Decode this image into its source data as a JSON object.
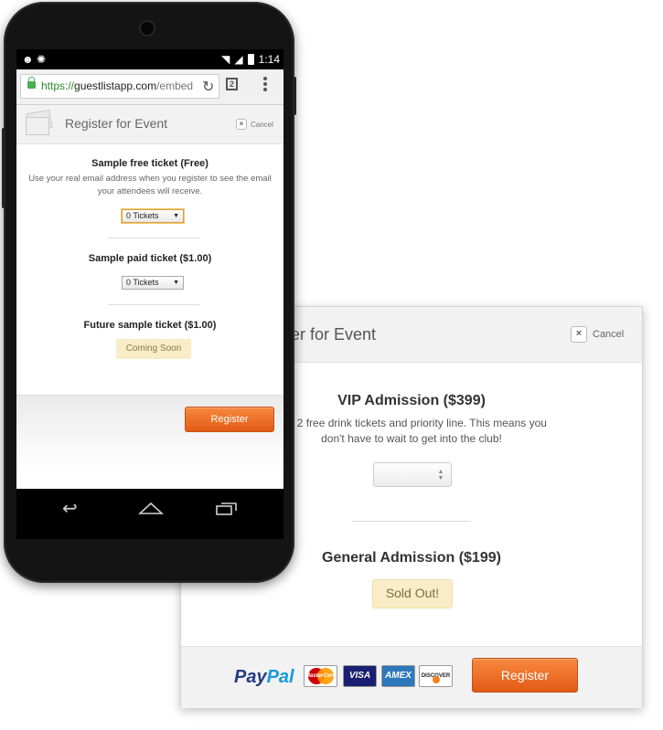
{
  "desktop": {
    "title": "er for Event",
    "cancel_label": "Cancel",
    "tickets": [
      {
        "name": "VIP Admission ($399)",
        "description": "des 2 free drink tickets and priority line. This means you don't have to wait to get into the club!",
        "select_value": ""
      },
      {
        "name": "General Admission ($199)",
        "status": "Sold Out!"
      }
    ],
    "payment": {
      "paypal_a": "Pay",
      "paypal_b": "Pal",
      "cards": [
        "MasterCard",
        "VISA",
        "AMEX",
        "DISCOVER"
      ]
    },
    "register_label": "Register"
  },
  "phone": {
    "status": {
      "time": "1:14"
    },
    "browser": {
      "url_scheme": "https://",
      "url_host": "guestlistapp.com",
      "url_path": "/embed",
      "tab_count": "2"
    },
    "title": "Register for Event",
    "cancel_label": "Cancel",
    "tickets": [
      {
        "name": "Sample free ticket (Free)",
        "description": "Use your real email address when you register to see the email your attendees will receive.",
        "select_value": "0 Tickets"
      },
      {
        "name": "Sample paid ticket ($1.00)",
        "select_value": "0 Tickets"
      },
      {
        "name": "Future sample ticket ($1.00)",
        "status": "Coming Soon"
      }
    ],
    "register_label": "Register"
  },
  "colors": {
    "accent": "#f07b30",
    "notice_bg": "#f8edc6",
    "url_green": "#2a8a2a"
  }
}
